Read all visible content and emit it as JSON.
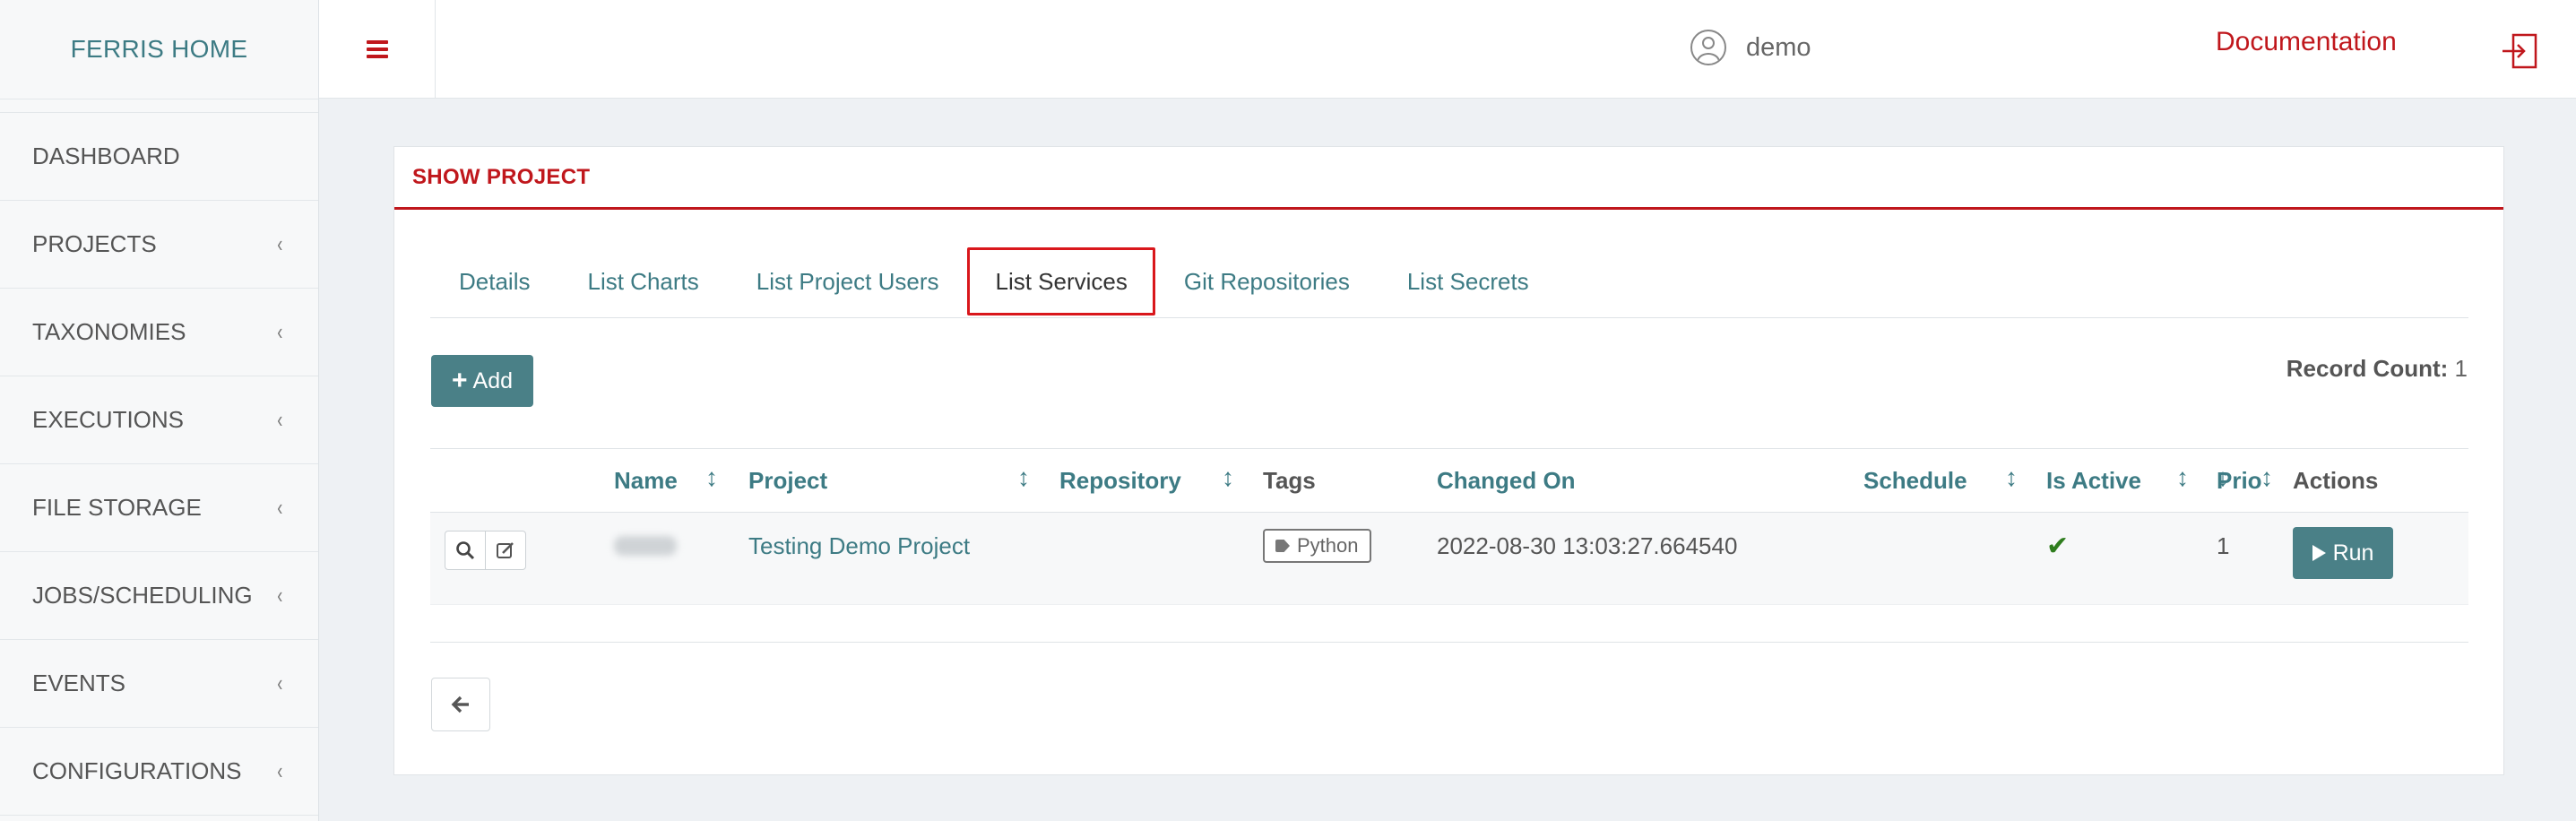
{
  "brand": {
    "title": "FERRIS HOME"
  },
  "sidebar": {
    "items": [
      {
        "label": "DASHBOARD",
        "has_submenu": false
      },
      {
        "label": "PROJECTS",
        "has_submenu": true
      },
      {
        "label": "TAXONOMIES",
        "has_submenu": true
      },
      {
        "label": "EXECUTIONS",
        "has_submenu": true
      },
      {
        "label": "FILE STORAGE",
        "has_submenu": true
      },
      {
        "label": "JOBS/SCHEDULING",
        "has_submenu": true
      },
      {
        "label": "EVENTS",
        "has_submenu": true
      },
      {
        "label": "CONFIGURATIONS",
        "has_submenu": true
      }
    ],
    "chevron": "‹"
  },
  "topbar": {
    "username": "demo",
    "documentation_label": "Documentation",
    "menu_icon": "hamburger-icon",
    "logout_icon": "logout-icon"
  },
  "panel": {
    "title": "SHOW PROJECT",
    "tabs": [
      {
        "label": "Details",
        "active": false
      },
      {
        "label": "List Charts",
        "active": false
      },
      {
        "label": "List Project Users",
        "active": false
      },
      {
        "label": "List Services",
        "active": true
      },
      {
        "label": "Git Repositories",
        "active": false
      },
      {
        "label": "List Secrets",
        "active": false
      }
    ],
    "add_button": {
      "icon": "+",
      "label": "Add"
    },
    "record_count": {
      "label": "Record Count:",
      "value": "1"
    }
  },
  "table": {
    "columns": [
      "Name",
      "Project",
      "Repository",
      "Tags",
      "Changed On",
      "Schedule",
      "Is Active",
      "Prio",
      "Actions"
    ],
    "sort_glyph": "↕",
    "rows": [
      {
        "name": "",
        "project": "Testing Demo Project",
        "repository": "",
        "tags": [
          "Python"
        ],
        "changed_on": "2022-08-30 13:03:27.664540",
        "schedule": "",
        "is_active": "✔",
        "prio": "1",
        "run_label": "Run"
      }
    ]
  },
  "colors": {
    "accent_red": "#c0171c",
    "teal": "#3d7b84",
    "button_teal": "#4a8087",
    "active_check": "#2f7d1e"
  }
}
